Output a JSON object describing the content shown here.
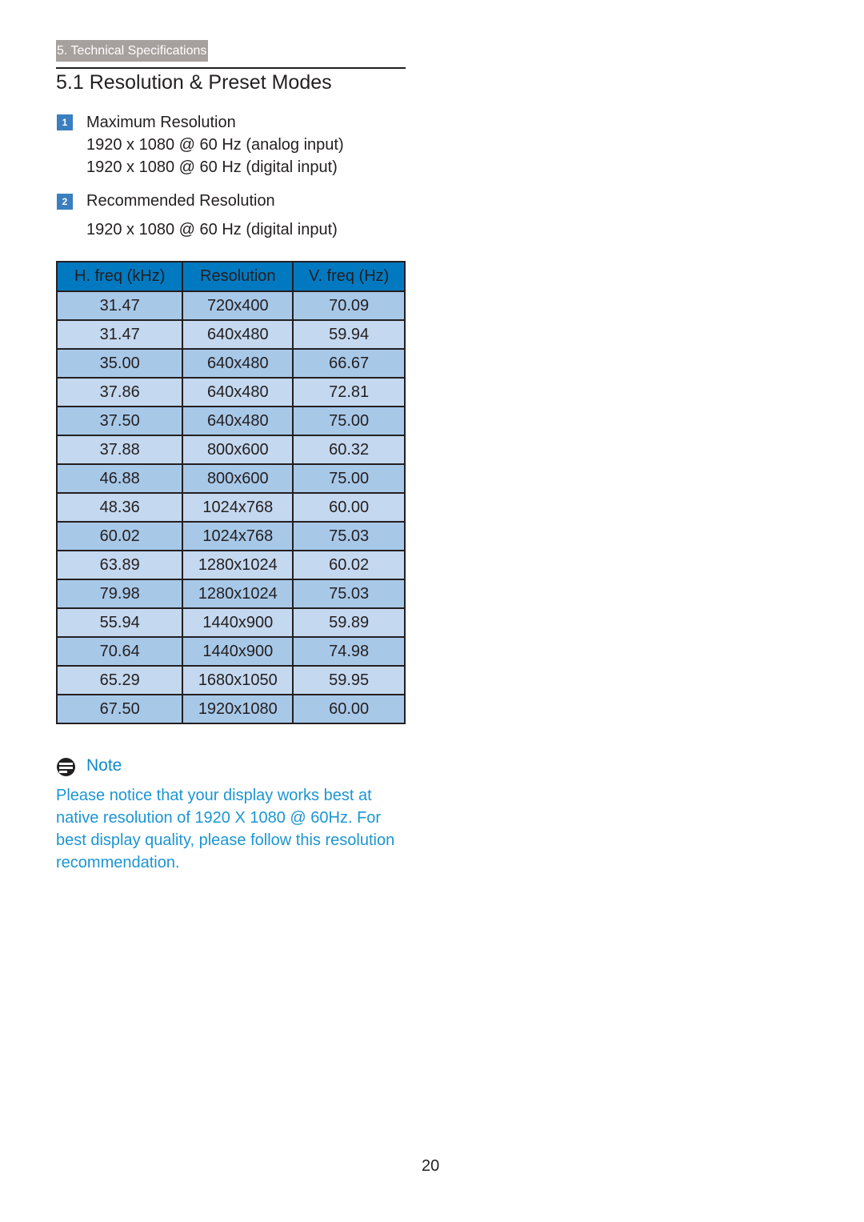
{
  "header": {
    "section_tag": "5. Technical Specifications",
    "page_title": "5.1  Resolution & Preset Modes"
  },
  "specs": [
    {
      "badge": "1",
      "heading": "Maximum Resolution",
      "lines": [
        "1920 x 1080 @ 60 Hz (analog input)",
        "1920 x 1080 @ 60 Hz (digital input)"
      ]
    },
    {
      "badge": "2",
      "heading": "Recommended Resolution",
      "lines": [
        "1920 x 1080 @ 60 Hz (digital input)"
      ]
    }
  ],
  "table": {
    "headers": [
      "H. freq (kHz)",
      "Resolution",
      "V. freq (Hz)"
    ],
    "rows": [
      [
        "31.47",
        "720x400",
        "70.09"
      ],
      [
        "31.47",
        "640x480",
        "59.94"
      ],
      [
        "35.00",
        "640x480",
        "66.67"
      ],
      [
        "37.86",
        "640x480",
        "72.81"
      ],
      [
        "37.50",
        "640x480",
        "75.00"
      ],
      [
        "37.88",
        "800x600",
        "60.32"
      ],
      [
        "46.88",
        "800x600",
        "75.00"
      ],
      [
        "48.36",
        "1024x768",
        "60.00"
      ],
      [
        "60.02",
        "1024x768",
        "75.03"
      ],
      [
        "63.89",
        "1280x1024",
        "60.02"
      ],
      [
        "79.98",
        "1280x1024",
        "75.03"
      ],
      [
        "55.94",
        "1440x900",
        "59.89"
      ],
      [
        "70.64",
        "1440x900",
        "74.98"
      ],
      [
        "65.29",
        "1680x1050",
        "59.95"
      ],
      [
        "67.50",
        "1920x1080",
        "60.00"
      ]
    ]
  },
  "note": {
    "icon": "note-icon",
    "label": "Note",
    "body": "Please notice that your display works best at native resolution of 1920 X 1080 @ 60Hz. For best display quality, please follow this resolution recommendation."
  },
  "footer": {
    "page_number": "20"
  },
  "colors": {
    "header_blue": "#0079c1",
    "row_dark": "#a8c8e8",
    "row_light": "#c4d8ef",
    "note_text": "#1c95d2",
    "badge_blue": "#3a7fbf",
    "tag_gray": "#a7a19e"
  }
}
